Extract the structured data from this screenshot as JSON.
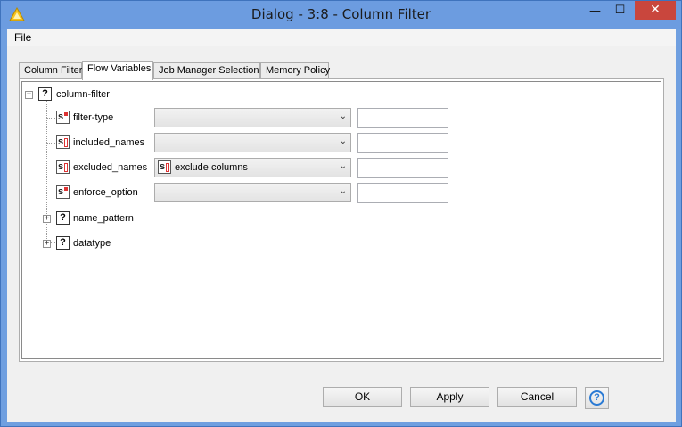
{
  "window": {
    "title": "Dialog - 3:8 - Column Filter",
    "minimize_glyph": "—",
    "maximize_glyph": "☐",
    "close_glyph": "✕"
  },
  "menu": {
    "file": "File"
  },
  "tabs": [
    {
      "label": "Column Filter",
      "active": false
    },
    {
      "label": "Flow Variables",
      "active": true
    },
    {
      "label": "Job Manager Selection",
      "active": false
    },
    {
      "label": "Memory Policy",
      "active": false
    }
  ],
  "tree": {
    "root": {
      "label": "column-filter",
      "icon": "question-icon",
      "expander": "−"
    },
    "children": [
      {
        "label": "filter-type",
        "icon": "string-variable-icon",
        "combo_value": "",
        "text_value": ""
      },
      {
        "label": "included_names",
        "icon": "string-array-variable-icon",
        "combo_value": "",
        "text_value": ""
      },
      {
        "label": "excluded_names",
        "icon": "string-array-variable-icon",
        "combo_value": "exclude columns",
        "text_value": ""
      },
      {
        "label": "enforce_option",
        "icon": "string-variable-icon",
        "combo_value": "",
        "text_value": ""
      },
      {
        "label": "name_pattern",
        "icon": "question-icon",
        "expander": "+"
      },
      {
        "label": "datatype",
        "icon": "question-icon",
        "expander": "+"
      }
    ]
  },
  "buttons": {
    "ok": "OK",
    "apply": "Apply",
    "cancel": "Cancel",
    "help": "?"
  },
  "icon_glyphs": {
    "question": "?",
    "string": "s",
    "combo_arrow": "⌄"
  },
  "colors": {
    "titlebar": "#6c9ce0",
    "close": "#c9463d",
    "variable_accent": "#d33333",
    "help": "#2a7ad4"
  }
}
